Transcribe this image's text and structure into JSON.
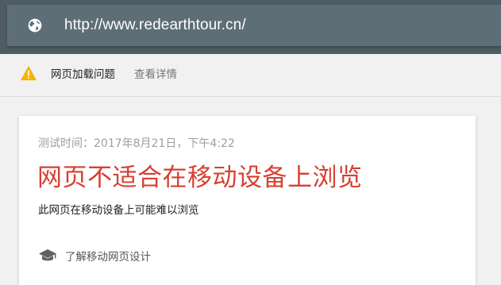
{
  "address_bar": {
    "icon": "globe-icon",
    "url": "http://www.redearthtour.cn/"
  },
  "issues_bar": {
    "icon": "warning-icon",
    "warning_color": "#f4b400",
    "label": "网页加载问题",
    "details_link": "查看详情"
  },
  "result_card": {
    "test_time": "测试时间：2017年8月21日，下午4:22",
    "headline": "网页不适合在移动设备上浏览",
    "headline_color": "#d74032",
    "description": "此网页在移动设备上可能难以浏览",
    "learn_icon": "graduation-cap-icon",
    "learn_link": "了解移动网页设计"
  }
}
